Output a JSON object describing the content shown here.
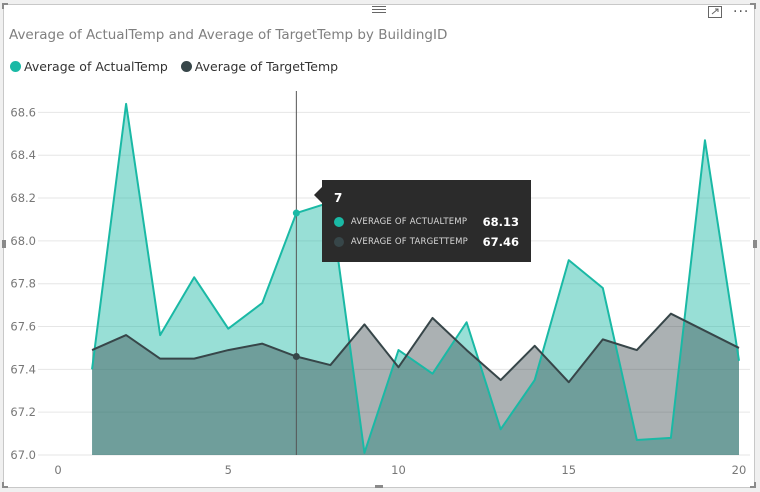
{
  "colors": {
    "actual": "#1ab9a5",
    "target": "#374649",
    "grid": "#e6e6e6",
    "axis_text": "#777777"
  },
  "icons": {
    "focus_mode": "focus-mode-icon",
    "more_options": "more-options-icon",
    "drag_grip": "drag-grip-icon"
  },
  "visual": {
    "title": "Average of ActualTemp and Average of TargetTemp by BuildingID",
    "more_glyph": "···"
  },
  "legend": [
    {
      "label": "Average of ActualTemp",
      "color": "#1ab9a5"
    },
    {
      "label": "Average of TargetTemp",
      "color": "#374649"
    }
  ],
  "chart_data": {
    "type": "area",
    "title": "Average of ActualTemp and Average of TargetTemp by BuildingID",
    "xlabel": "",
    "ylabel": "",
    "xlim": [
      0,
      20
    ],
    "ylim": [
      67.0,
      68.7
    ],
    "x_ticks": [
      0,
      5,
      10,
      15,
      20
    ],
    "y_ticks": [
      67.0,
      67.2,
      67.4,
      67.6,
      67.8,
      68.0,
      68.2,
      68.4,
      68.6
    ],
    "grid": true,
    "legend_position": "top-left",
    "x": [
      1,
      2,
      3,
      4,
      5,
      6,
      7,
      8,
      9,
      10,
      11,
      12,
      13,
      14,
      15,
      16,
      17,
      18,
      19,
      20
    ],
    "series": [
      {
        "name": "Average of ActualTemp",
        "color": "#1ab9a5",
        "values": [
          67.4,
          68.64,
          67.56,
          67.83,
          67.59,
          67.71,
          68.13,
          68.18,
          67.01,
          67.49,
          67.38,
          67.62,
          67.12,
          67.35,
          67.91,
          67.78,
          67.07,
          67.08,
          68.47,
          67.44
        ]
      },
      {
        "name": "Average of TargetTemp",
        "color": "#374649",
        "values": [
          67.49,
          67.56,
          67.45,
          67.45,
          67.49,
          67.52,
          67.46,
          67.42,
          67.61,
          67.41,
          67.64,
          67.49,
          67.35,
          67.51,
          67.34,
          67.54,
          67.49,
          67.66,
          67.58,
          67.5
        ]
      }
    ],
    "hover": {
      "x": 7,
      "header": "7",
      "rows": [
        {
          "label": "AVERAGE OF ACTUALTEMP",
          "value": "68.13"
        },
        {
          "label": "AVERAGE OF TARGETTEMP",
          "value": "67.46"
        }
      ]
    }
  }
}
